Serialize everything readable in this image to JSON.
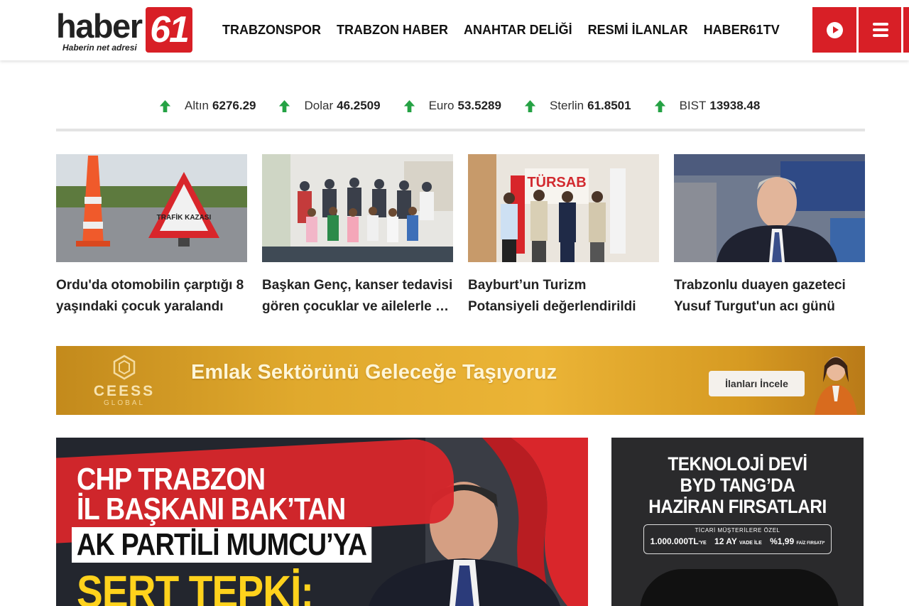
{
  "header": {
    "logo_word": "haber",
    "logo_number": "61",
    "logo_tagline": "Haberin net adresi",
    "nav": [
      "TRABZONSPOR",
      "TRABZON HABER",
      "ANAHTAR DELİĞİ",
      "RESMİ İLANLAR",
      "HABER61TV"
    ],
    "icons": {
      "live": "play-icon",
      "menu": "menu-icon"
    },
    "brand_color": "#d81f26"
  },
  "ticker": [
    {
      "name": "Altın",
      "value": "6276.29",
      "trend": "up"
    },
    {
      "name": "Dolar",
      "value": "46.2509",
      "trend": "up"
    },
    {
      "name": "Euro",
      "value": "53.5289",
      "trend": "up"
    },
    {
      "name": "Sterlin",
      "value": "61.8501",
      "trend": "up"
    },
    {
      "name": "BIST",
      "value": "13938.48",
      "trend": "up"
    }
  ],
  "news": [
    {
      "title": "Ordu'da otomobilin çarptığı 8 yaşındaki çocuk yaralandı",
      "sign_text": "TRAFİK KAZASI"
    },
    {
      "title": "Başkan Genç, kanser tedavisi gören çocuklar ve ailelerle bir araya geldi"
    },
    {
      "title": "Bayburt’un Turizm Potansiyeli değerlendirildi",
      "sign_text": "TÜRSAB"
    },
    {
      "title": "Trabzonlu duayen gazeteci Yusuf Turgut'un acı günü"
    }
  ],
  "banner": {
    "brand": "CEESS",
    "brand_sub": "GLOBAL",
    "headline": "Emlak Sektörünü Geleceğe Taşıyoruz",
    "button": "İlanları İncele"
  },
  "feature": {
    "lines": [
      "CHP TRABZON",
      "İL BAŞKANI BAK’TAN",
      "AK PARTİLİ MUMCU’YA",
      "SERT TEPKİ:"
    ]
  },
  "side_ad": {
    "lines": [
      "TEKNOLOJİ DEVİ",
      "BYD TANG’DA",
      "HAZİRAN FIRSATLARI"
    ],
    "offer_top": "TİCARİ MÜŞTERİLERE ÖZEL",
    "offer_amount": "1.000.000TL",
    "offer_amount_suffix": "'YE",
    "offer_term": "12 AY",
    "offer_term_suffix": "VADE İLE",
    "offer_rate": "%1,99",
    "offer_rate_suffix": "FAİZ FIRSATI*"
  }
}
